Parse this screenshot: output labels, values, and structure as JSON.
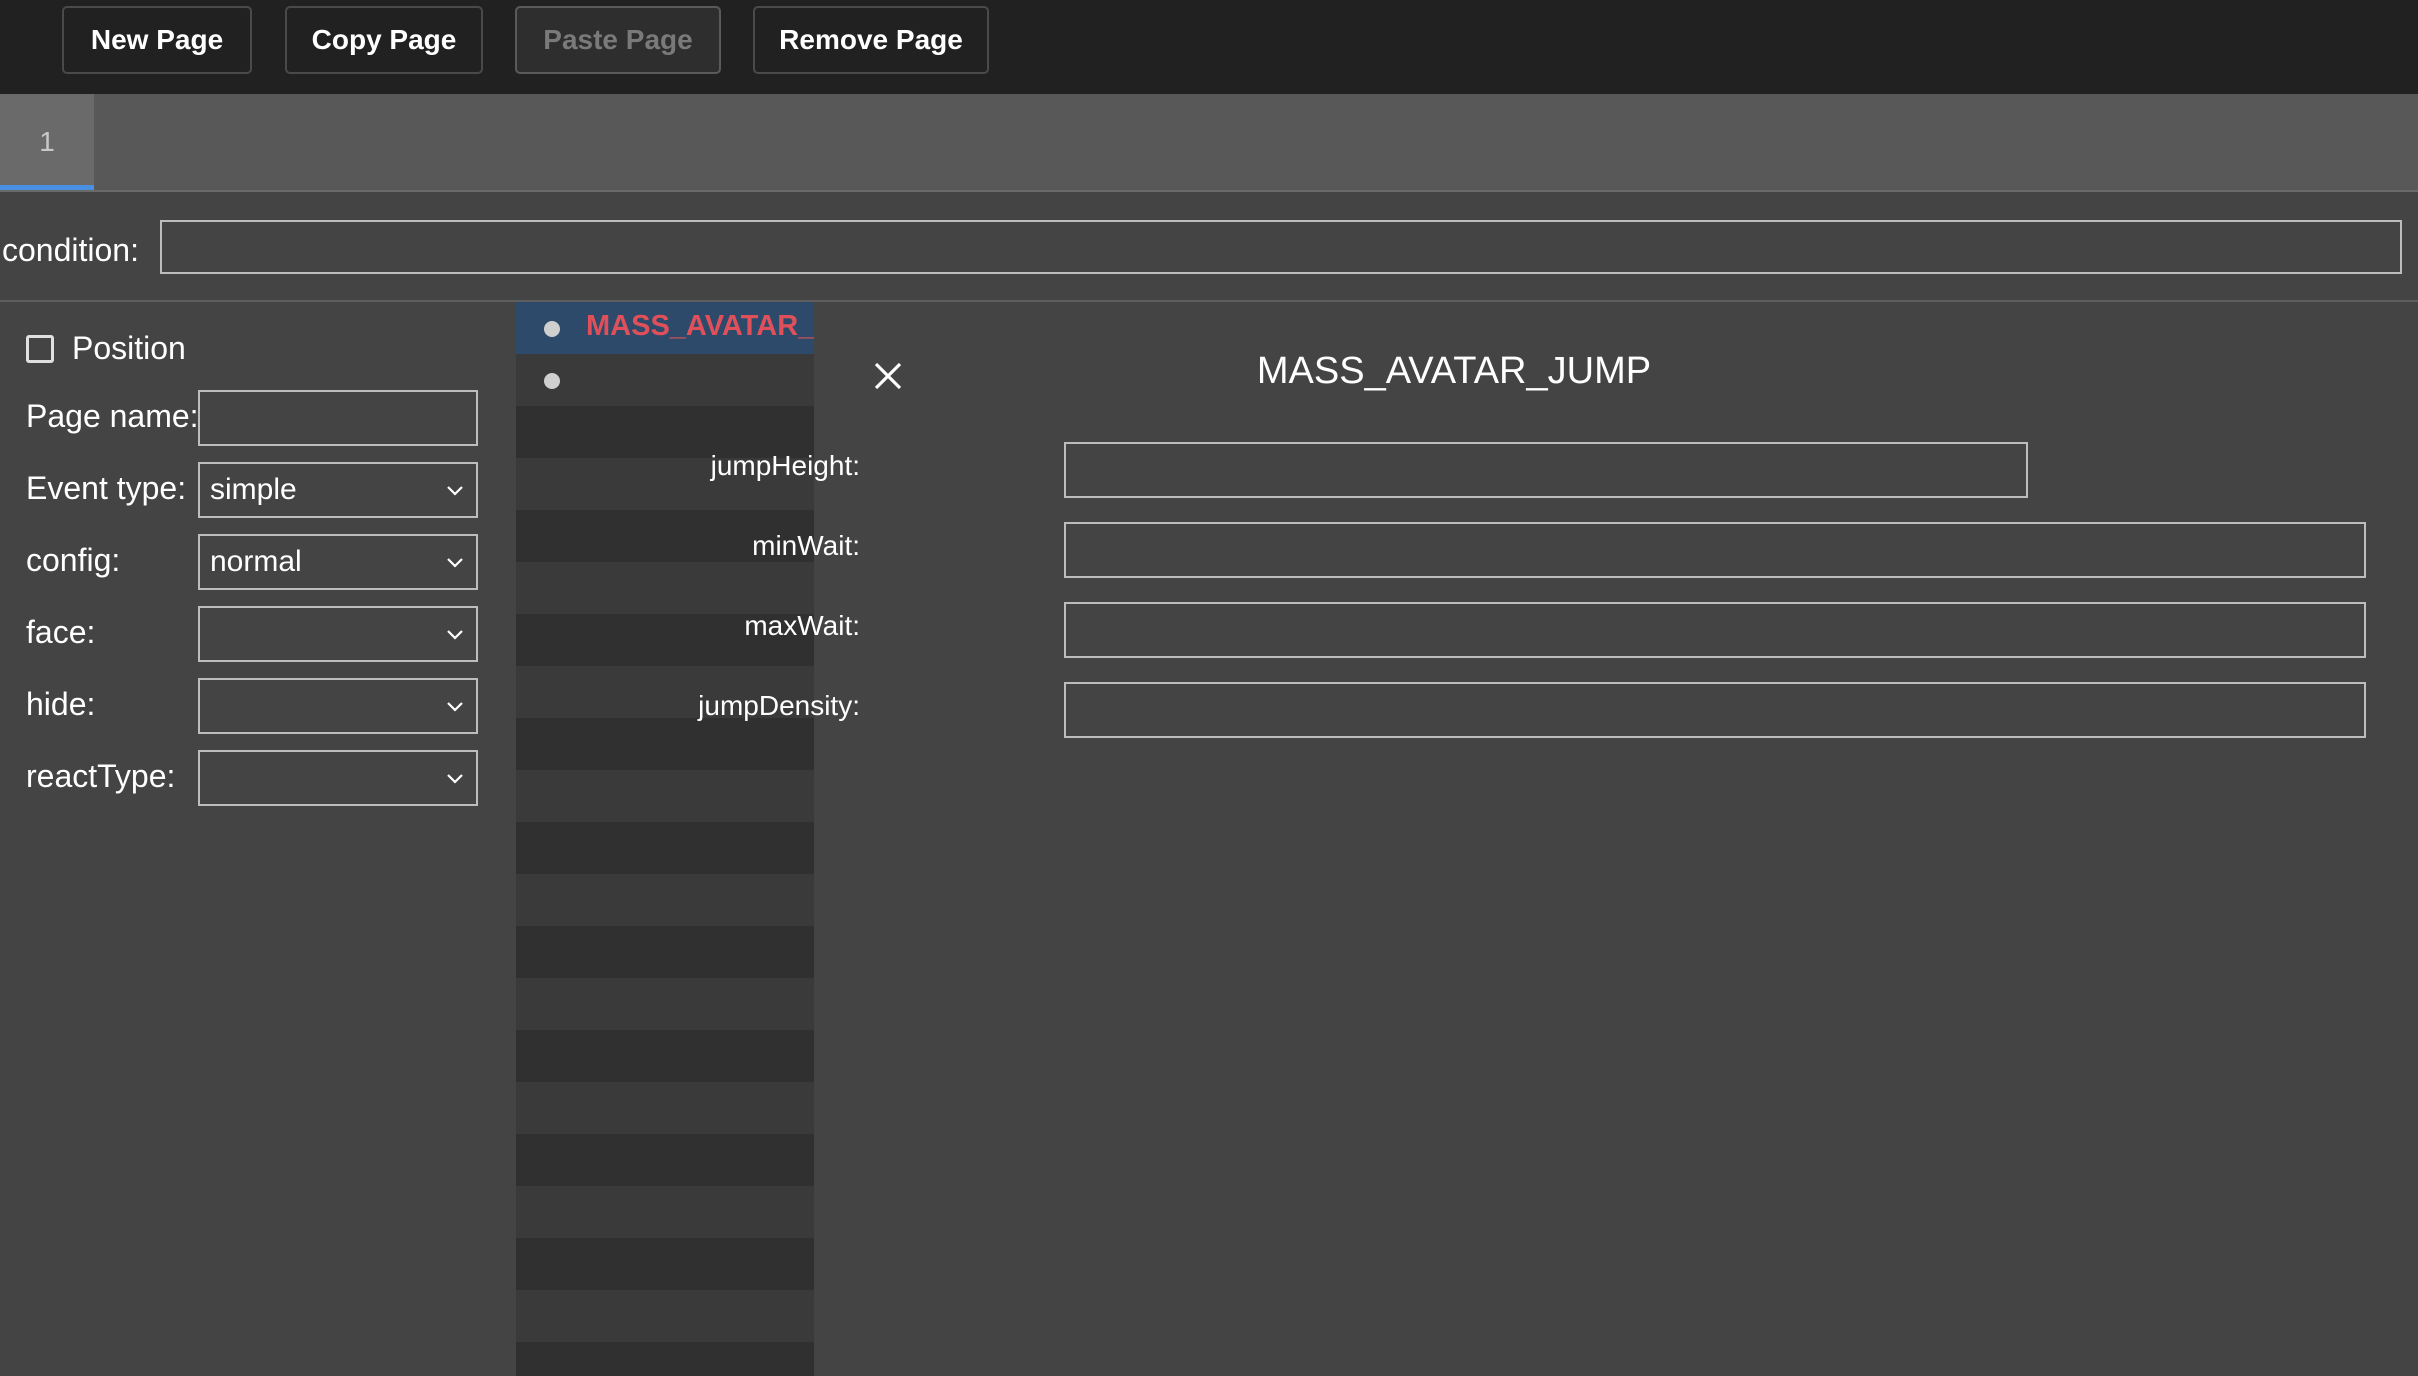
{
  "toolbar": {
    "new_page": "New Page",
    "copy_page": "Copy Page",
    "paste_page": "Paste Page",
    "remove_page": "Remove Page"
  },
  "tabs": [
    {
      "label": "1",
      "active": true
    }
  ],
  "condition": {
    "label": "condition:",
    "value": ""
  },
  "left": {
    "position_label": "Position",
    "position_checked": false,
    "page_name_label": "Page name:",
    "page_name_value": "",
    "event_type_label": "Event type:",
    "event_type_value": "simple",
    "config_label": "config:",
    "config_value": "normal",
    "face_label": "face:",
    "face_value": "",
    "hide_label": "hide:",
    "hide_value": "",
    "react_type_label": "reactType:",
    "react_type_value": ""
  },
  "list": {
    "items": [
      {
        "label": "MASS_AVATAR_JUMP",
        "selected": true
      },
      {
        "label": "",
        "selected": false
      }
    ]
  },
  "detail": {
    "title": "MASS_AVATAR_JUMP",
    "params": [
      {
        "label": "jumpHeight:",
        "value": ""
      },
      {
        "label": "minWait:",
        "value": ""
      },
      {
        "label": "maxWait:",
        "value": ""
      },
      {
        "label": "jumpDensity:",
        "value": ""
      }
    ]
  },
  "colors": {
    "toolbar_bg": "#212121",
    "panel_bg": "#444444",
    "selected_row": "#2d4a6a",
    "selected_text": "#e0505a",
    "tab_accent": "#4a90e2"
  }
}
